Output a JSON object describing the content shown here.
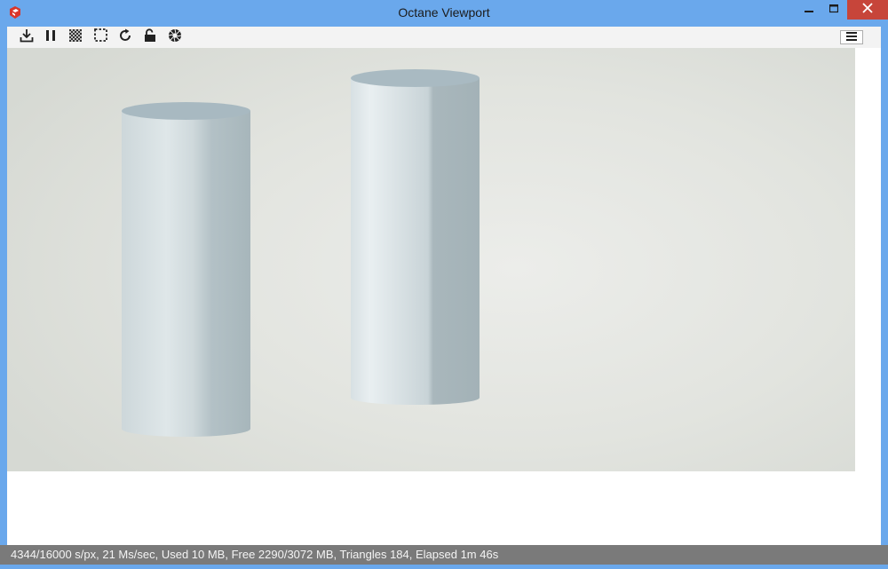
{
  "window": {
    "title": "Octane Viewport",
    "controls": [
      "minimize-icon",
      "maximize-icon",
      "close-icon"
    ]
  },
  "toolbar": {
    "tools": [
      {
        "name": "save-render-button",
        "icon": "download-icon"
      },
      {
        "name": "pause-render-button",
        "icon": "pause-icon"
      },
      {
        "name": "alpha-toggle-button",
        "icon": "checkerboard-icon"
      },
      {
        "name": "region-select-button",
        "icon": "dashed-rectangle-icon"
      },
      {
        "name": "restart-render-button",
        "icon": "refresh-icon"
      },
      {
        "name": "lock-viewport-button",
        "icon": "padlock-open-icon"
      },
      {
        "name": "camera-aperture-button",
        "icon": "aperture-icon"
      }
    ],
    "menu_icon": "hamburger-menu-icon"
  },
  "viewport": {
    "content": "rendered scene with two cylinders",
    "colors": {
      "background": "#e2e4df",
      "object": "#c8d4d8"
    }
  },
  "status": {
    "text": "4344/16000 s/px, 21 Ms/sec, Used 10 MB, Free 2290/3072 MB, Triangles 184, Elapsed 1m 46s"
  },
  "colors": {
    "frame": "#6aa8ec",
    "close_button": "#c7453a",
    "statusbar": "#7a7a7a"
  }
}
